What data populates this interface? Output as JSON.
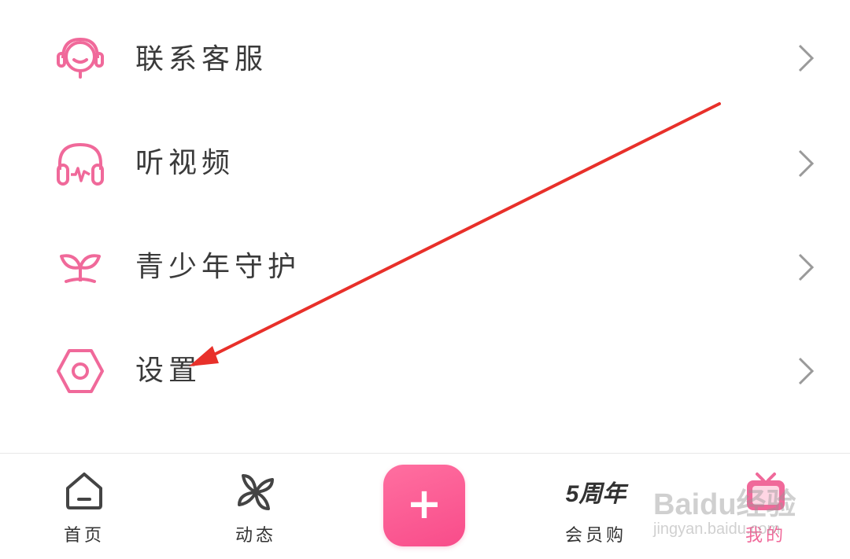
{
  "menu": {
    "items": [
      {
        "label": "联系客服",
        "icon": "headset-icon"
      },
      {
        "label": "听视频",
        "icon": "headphones-icon"
      },
      {
        "label": "青少年守护",
        "icon": "sprout-icon"
      },
      {
        "label": "设置",
        "icon": "gear-icon"
      }
    ]
  },
  "tabbar": {
    "home_label": "首页",
    "dynamic_label": "动态",
    "add_label": "+",
    "vip_label": "会员购",
    "vip_badge": "5周年",
    "mine_label": "我的"
  },
  "watermark": {
    "brand": "Baidu经验",
    "url": "jingyan.baidu.com"
  },
  "colors": {
    "accent": "#f0699a",
    "text": "#3a3a3a",
    "arrow": "#e8302a"
  }
}
